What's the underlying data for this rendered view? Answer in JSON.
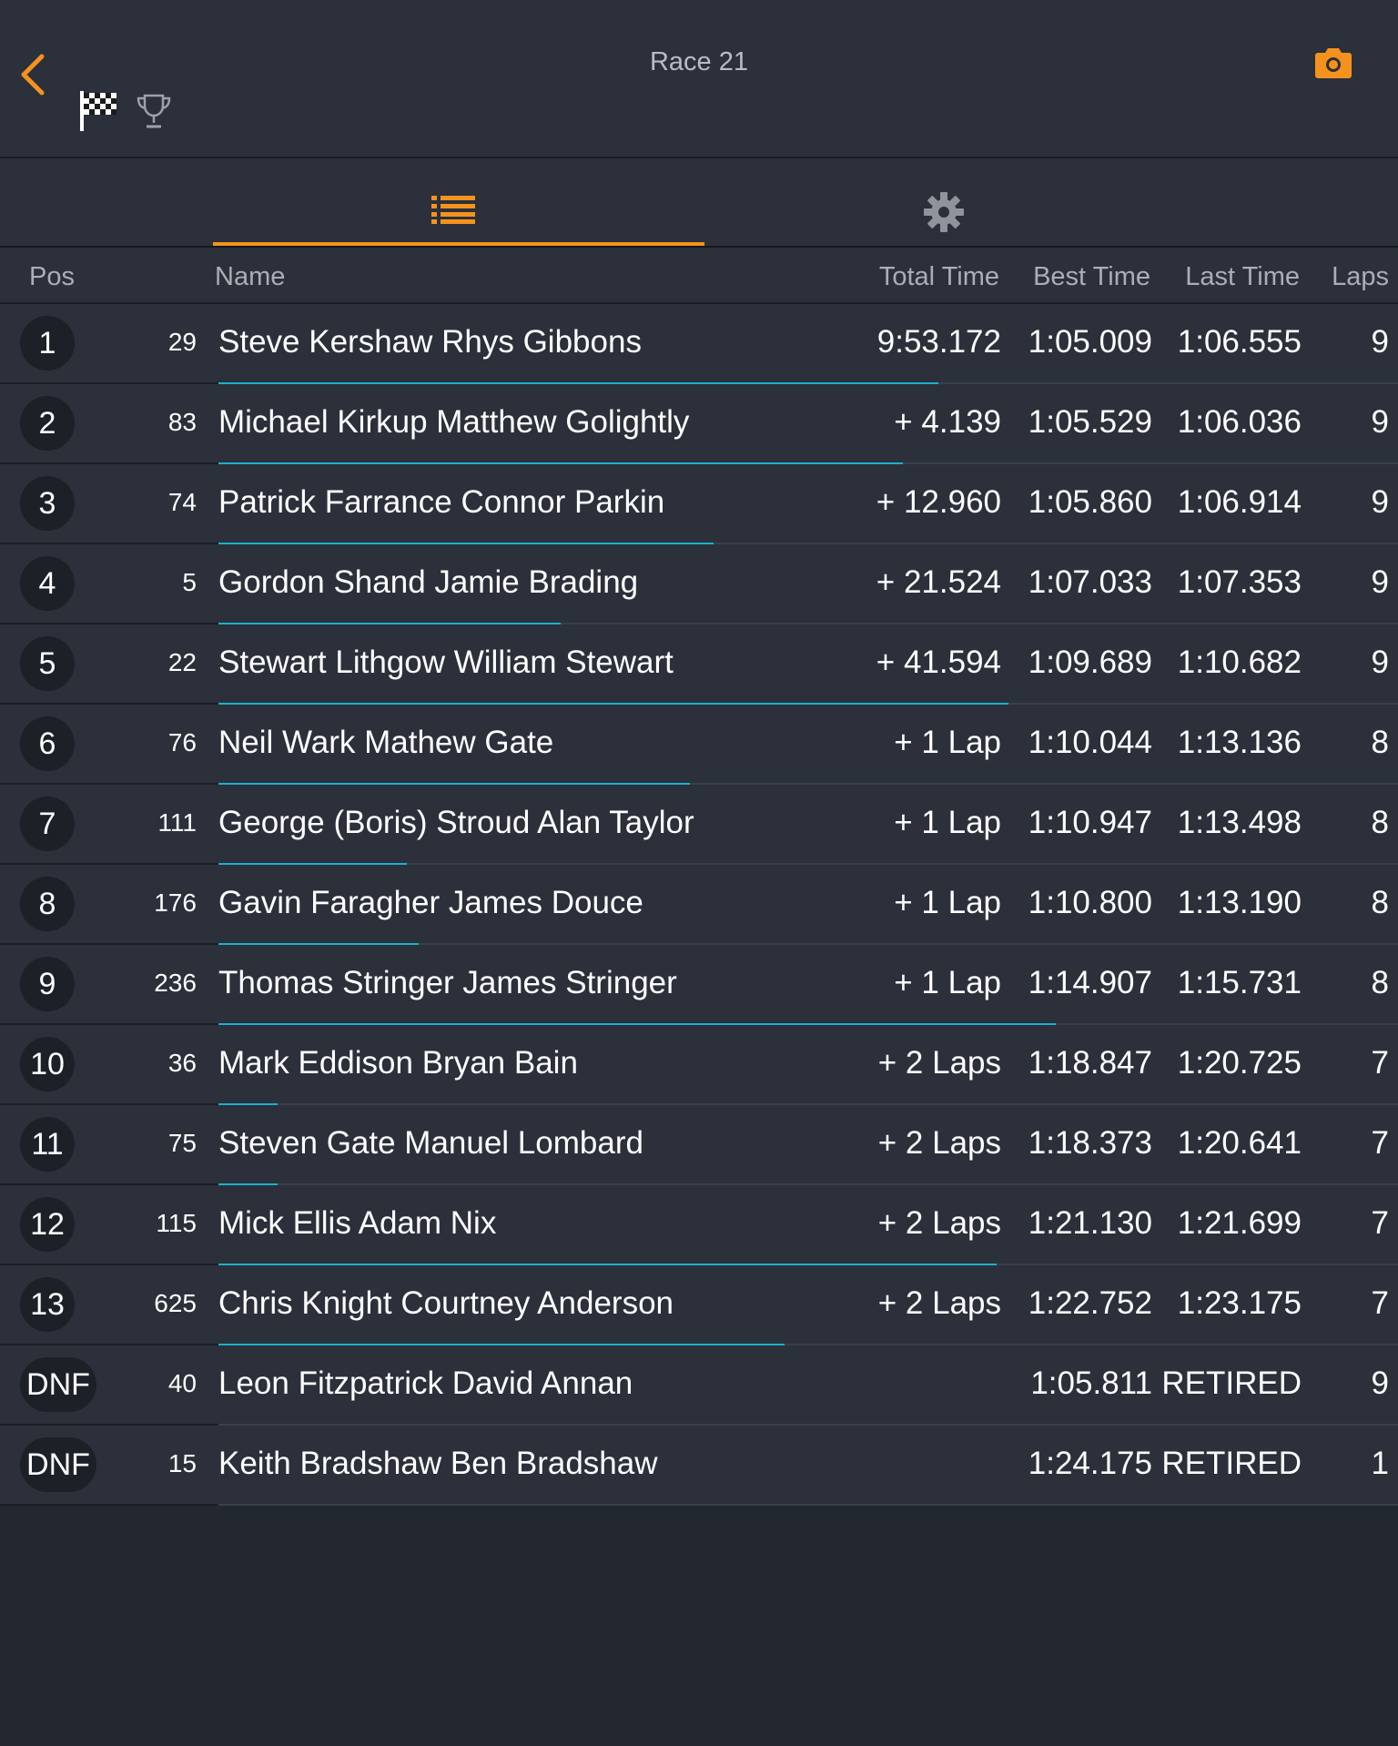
{
  "header": {
    "title": "Race 21"
  },
  "colors": {
    "accent": "#f5921e",
    "progress": "#1cb0cf",
    "background": "#23272f",
    "panel": "#2b303a"
  },
  "icons": {
    "back": "chevron-left-icon",
    "flag": "checkered-flag-icon",
    "trophy": "trophy-icon",
    "camera": "camera-icon",
    "list": "list-icon",
    "settings": "gear-icon"
  },
  "tabs": {
    "active": "list"
  },
  "columns": {
    "pos": "Pos",
    "name": "Name",
    "total": "Total Time",
    "best": "Best Time",
    "last": "Last Time",
    "laps": "Laps"
  },
  "rows": [
    {
      "pos": "1",
      "num": "29",
      "name": "Steve Kershaw Rhys Gibbons",
      "total": "9:53.172",
      "best": "1:05.009",
      "last": "1:06.555",
      "laps": "9",
      "progress": 0.61
    },
    {
      "pos": "2",
      "num": "83",
      "name": "Michael Kirkup Matthew Golightly",
      "total": "+ 4.139",
      "best": "1:05.529",
      "last": "1:06.036",
      "laps": "9",
      "progress": 0.58
    },
    {
      "pos": "3",
      "num": "74",
      "name": "Patrick Farrance Connor Parkin",
      "total": "+ 12.960",
      "best": "1:05.860",
      "last": "1:06.914",
      "laps": "9",
      "progress": 0.42
    },
    {
      "pos": "4",
      "num": "5",
      "name": "Gordon Shand Jamie Brading",
      "total": "+ 21.524",
      "best": "1:07.033",
      "last": "1:07.353",
      "laps": "9",
      "progress": 0.29
    },
    {
      "pos": "5",
      "num": "22",
      "name": "Stewart Lithgow William Stewart",
      "total": "+ 41.594",
      "best": "1:09.689",
      "last": "1:10.682",
      "laps": "9",
      "progress": 0.67
    },
    {
      "pos": "6",
      "num": "76",
      "name": "Neil Wark Mathew Gate",
      "total": "+ 1 Lap",
      "best": "1:10.044",
      "last": "1:13.136",
      "laps": "8",
      "progress": 0.4
    },
    {
      "pos": "7",
      "num": "111",
      "name": "George (Boris) Stroud Alan Taylor",
      "total": "+ 1 Lap",
      "best": "1:10.947",
      "last": "1:13.498",
      "laps": "8",
      "progress": 0.16
    },
    {
      "pos": "8",
      "num": "176",
      "name": "Gavin Faragher James Douce",
      "total": "+ 1 Lap",
      "best": "1:10.800",
      "last": "1:13.190",
      "laps": "8",
      "progress": 0.17
    },
    {
      "pos": "9",
      "num": "236",
      "name": "Thomas Stringer James Stringer",
      "total": "+ 1 Lap",
      "best": "1:14.907",
      "last": "1:15.731",
      "laps": "8",
      "progress": 0.71
    },
    {
      "pos": "10",
      "num": "36",
      "name": "Mark Eddison Bryan Bain",
      "total": "+ 2 Laps",
      "best": "1:18.847",
      "last": "1:20.725",
      "laps": "7",
      "progress": 0.05
    },
    {
      "pos": "11",
      "num": "75",
      "name": "Steven Gate Manuel Lombard",
      "total": "+ 2 Laps",
      "best": "1:18.373",
      "last": "1:20.641",
      "laps": "7",
      "progress": 0.05
    },
    {
      "pos": "12",
      "num": "115",
      "name": "Mick Ellis Adam Nix",
      "total": "+ 2 Laps",
      "best": "1:21.130",
      "last": "1:21.699",
      "laps": "7",
      "progress": 0.66
    },
    {
      "pos": "13",
      "num": "625",
      "name": "Chris Knight Courtney Anderson",
      "total": "+ 2 Laps",
      "best": "1:22.752",
      "last": "1:23.175",
      "laps": "7",
      "progress": 0.48
    },
    {
      "pos": "DNF",
      "num": "40",
      "name": "Leon Fitzpatrick David Annan",
      "total": "",
      "best": "1:05.811",
      "last": "RETIRED",
      "laps": "9",
      "progress": 0
    },
    {
      "pos": "DNF",
      "num": "15",
      "name": "Keith Bradshaw Ben Bradshaw",
      "total": "",
      "best": "1:24.175",
      "last": "RETIRED",
      "laps": "1",
      "progress": 0
    }
  ]
}
